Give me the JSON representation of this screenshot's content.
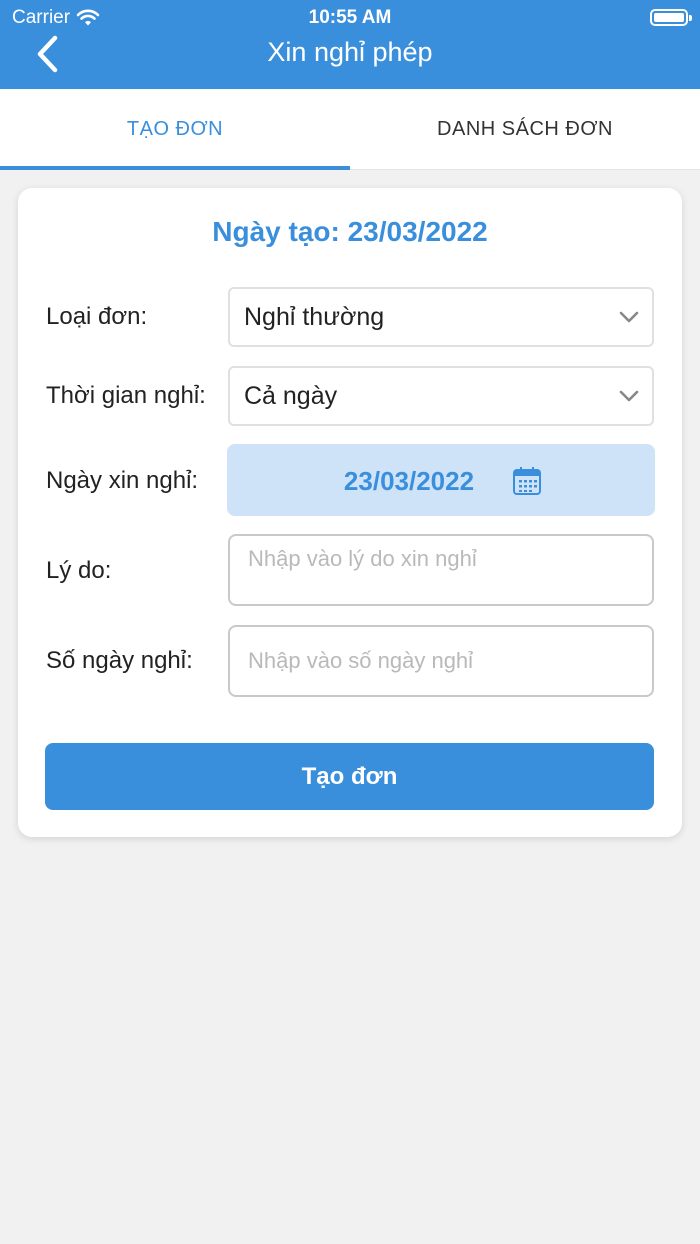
{
  "status_bar": {
    "carrier": "Carrier",
    "time": "10:55 AM"
  },
  "header": {
    "title": "Xin nghỉ phép",
    "back_icon": "chevron-left-icon"
  },
  "tabs": [
    {
      "label": "TẠO ĐƠN",
      "active": true
    },
    {
      "label": "DANH SÁCH ĐƠN",
      "active": false
    }
  ],
  "form": {
    "created_date": "Ngày tạo: 23/03/2022",
    "leave_type": {
      "label": "Loại đơn:",
      "value": "Nghỉ thường"
    },
    "leave_time": {
      "label": "Thời gian nghỉ:",
      "value": "Cả ngày"
    },
    "leave_date": {
      "label": "Ngày xin nghỉ:",
      "value": "23/03/2022",
      "icon": "calendar-icon"
    },
    "reason": {
      "label": "Lý do:",
      "placeholder": "Nhập vào lý do xin nghỉ",
      "value": ""
    },
    "days": {
      "label": "Số ngày nghỉ:",
      "placeholder": "Nhập vào số ngày nghỉ",
      "value": ""
    },
    "submit_label": "Tạo đơn"
  },
  "colors": {
    "primary": "#3a8fdd",
    "date_picker_bg": "#cfe3f8",
    "background": "#f1f1f1"
  }
}
